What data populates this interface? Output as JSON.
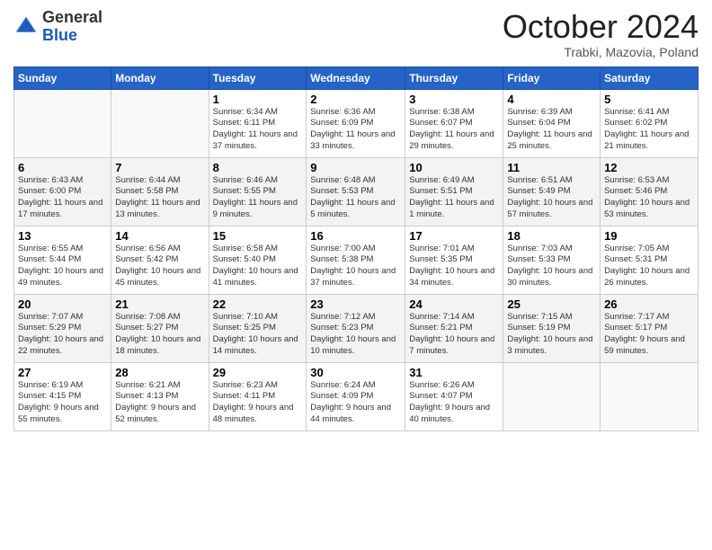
{
  "logo": {
    "general": "General",
    "blue": "Blue"
  },
  "header": {
    "month": "October 2024",
    "location": "Trabki, Mazovia, Poland"
  },
  "days_of_week": [
    "Sunday",
    "Monday",
    "Tuesday",
    "Wednesday",
    "Thursday",
    "Friday",
    "Saturday"
  ],
  "weeks": [
    [
      {
        "day": "",
        "info": ""
      },
      {
        "day": "",
        "info": ""
      },
      {
        "day": "1",
        "info": "Sunrise: 6:34 AM\nSunset: 6:11 PM\nDaylight: 11 hours and 37 minutes."
      },
      {
        "day": "2",
        "info": "Sunrise: 6:36 AM\nSunset: 6:09 PM\nDaylight: 11 hours and 33 minutes."
      },
      {
        "day": "3",
        "info": "Sunrise: 6:38 AM\nSunset: 6:07 PM\nDaylight: 11 hours and 29 minutes."
      },
      {
        "day": "4",
        "info": "Sunrise: 6:39 AM\nSunset: 6:04 PM\nDaylight: 11 hours and 25 minutes."
      },
      {
        "day": "5",
        "info": "Sunrise: 6:41 AM\nSunset: 6:02 PM\nDaylight: 11 hours and 21 minutes."
      }
    ],
    [
      {
        "day": "6",
        "info": "Sunrise: 6:43 AM\nSunset: 6:00 PM\nDaylight: 11 hours and 17 minutes."
      },
      {
        "day": "7",
        "info": "Sunrise: 6:44 AM\nSunset: 5:58 PM\nDaylight: 11 hours and 13 minutes."
      },
      {
        "day": "8",
        "info": "Sunrise: 6:46 AM\nSunset: 5:55 PM\nDaylight: 11 hours and 9 minutes."
      },
      {
        "day": "9",
        "info": "Sunrise: 6:48 AM\nSunset: 5:53 PM\nDaylight: 11 hours and 5 minutes."
      },
      {
        "day": "10",
        "info": "Sunrise: 6:49 AM\nSunset: 5:51 PM\nDaylight: 11 hours and 1 minute."
      },
      {
        "day": "11",
        "info": "Sunrise: 6:51 AM\nSunset: 5:49 PM\nDaylight: 10 hours and 57 minutes."
      },
      {
        "day": "12",
        "info": "Sunrise: 6:53 AM\nSunset: 5:46 PM\nDaylight: 10 hours and 53 minutes."
      }
    ],
    [
      {
        "day": "13",
        "info": "Sunrise: 6:55 AM\nSunset: 5:44 PM\nDaylight: 10 hours and 49 minutes."
      },
      {
        "day": "14",
        "info": "Sunrise: 6:56 AM\nSunset: 5:42 PM\nDaylight: 10 hours and 45 minutes."
      },
      {
        "day": "15",
        "info": "Sunrise: 6:58 AM\nSunset: 5:40 PM\nDaylight: 10 hours and 41 minutes."
      },
      {
        "day": "16",
        "info": "Sunrise: 7:00 AM\nSunset: 5:38 PM\nDaylight: 10 hours and 37 minutes."
      },
      {
        "day": "17",
        "info": "Sunrise: 7:01 AM\nSunset: 5:35 PM\nDaylight: 10 hours and 34 minutes."
      },
      {
        "day": "18",
        "info": "Sunrise: 7:03 AM\nSunset: 5:33 PM\nDaylight: 10 hours and 30 minutes."
      },
      {
        "day": "19",
        "info": "Sunrise: 7:05 AM\nSunset: 5:31 PM\nDaylight: 10 hours and 26 minutes."
      }
    ],
    [
      {
        "day": "20",
        "info": "Sunrise: 7:07 AM\nSunset: 5:29 PM\nDaylight: 10 hours and 22 minutes."
      },
      {
        "day": "21",
        "info": "Sunrise: 7:08 AM\nSunset: 5:27 PM\nDaylight: 10 hours and 18 minutes."
      },
      {
        "day": "22",
        "info": "Sunrise: 7:10 AM\nSunset: 5:25 PM\nDaylight: 10 hours and 14 minutes."
      },
      {
        "day": "23",
        "info": "Sunrise: 7:12 AM\nSunset: 5:23 PM\nDaylight: 10 hours and 10 minutes."
      },
      {
        "day": "24",
        "info": "Sunrise: 7:14 AM\nSunset: 5:21 PM\nDaylight: 10 hours and 7 minutes."
      },
      {
        "day": "25",
        "info": "Sunrise: 7:15 AM\nSunset: 5:19 PM\nDaylight: 10 hours and 3 minutes."
      },
      {
        "day": "26",
        "info": "Sunrise: 7:17 AM\nSunset: 5:17 PM\nDaylight: 9 hours and 59 minutes."
      }
    ],
    [
      {
        "day": "27",
        "info": "Sunrise: 6:19 AM\nSunset: 4:15 PM\nDaylight: 9 hours and 55 minutes."
      },
      {
        "day": "28",
        "info": "Sunrise: 6:21 AM\nSunset: 4:13 PM\nDaylight: 9 hours and 52 minutes."
      },
      {
        "day": "29",
        "info": "Sunrise: 6:23 AM\nSunset: 4:11 PM\nDaylight: 9 hours and 48 minutes."
      },
      {
        "day": "30",
        "info": "Sunrise: 6:24 AM\nSunset: 4:09 PM\nDaylight: 9 hours and 44 minutes."
      },
      {
        "day": "31",
        "info": "Sunrise: 6:26 AM\nSunset: 4:07 PM\nDaylight: 9 hours and 40 minutes."
      },
      {
        "day": "",
        "info": ""
      },
      {
        "day": "",
        "info": ""
      }
    ]
  ]
}
